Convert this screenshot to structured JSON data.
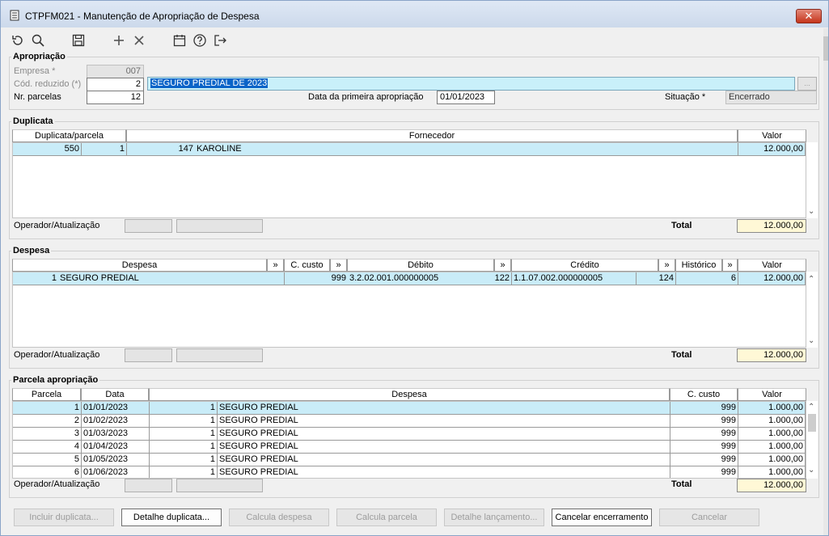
{
  "window": {
    "title": "CTPFM021 - Manutenção de Apropriação de Despesa",
    "close": "✕"
  },
  "toolbar": {
    "icons": [
      "refresh-icon",
      "search-icon",
      "save-icon",
      "add-icon",
      "delete-icon",
      "calendar-icon",
      "help-icon",
      "exit-icon"
    ]
  },
  "apropriacao": {
    "legend": "Apropriação",
    "empresa_label": "Empresa *",
    "empresa_value": "007",
    "cod_label": "Cód. reduzido (*)",
    "cod_value": "2",
    "cod_desc": "SEGURO PREDIAL DE 2023",
    "lookup_btn": "...",
    "nr_parcelas_label": "Nr. parcelas",
    "nr_parcelas_value": "12",
    "data_label": "Data da primeira apropriação",
    "data_value": "01/01/2023",
    "situacao_label": "Situação *",
    "situacao_value": "Encerrado"
  },
  "duplicata": {
    "legend": "Duplicata",
    "headers": [
      "Duplicata/parcela",
      "Fornecedor",
      "Valor"
    ],
    "rows": [
      {
        "duplicata": "550",
        "parcela": "1",
        "fornecedor_cod": "147",
        "fornecedor_nome": "KAROLINE",
        "valor": "12.000,00"
      }
    ],
    "operador_label": "Operador/Atualização",
    "total_label": "Total",
    "total_value": "12.000,00"
  },
  "despesa": {
    "legend": "Despesa",
    "headers": [
      "Despesa",
      "»",
      "C. custo",
      "»",
      "Débito",
      "»",
      "Crédito",
      "»",
      "Histórico",
      "»",
      "Valor"
    ],
    "rows": [
      {
        "cod": "1",
        "nome": "SEGURO PREDIAL",
        "ccusto": "999",
        "debito": "3.2.02.001.000000005",
        "debito_cod": "122",
        "credito": "1.1.07.002.000000005",
        "credito_cod": "124",
        "historico": "6",
        "valor": "12.000,00"
      }
    ],
    "operador_label": "Operador/Atualização",
    "total_label": "Total",
    "total_value": "12.000,00"
  },
  "parcela": {
    "legend": "Parcela apropriação",
    "headers": [
      "Parcela",
      "Data",
      "Despesa",
      "C. custo",
      "Valor"
    ],
    "rows": [
      {
        "parcela": "1",
        "data": "01/01/2023",
        "desp_cod": "1",
        "despesa": "SEGURO PREDIAL",
        "ccusto": "999",
        "valor": "1.000,00"
      },
      {
        "parcela": "2",
        "data": "01/02/2023",
        "desp_cod": "1",
        "despesa": "SEGURO PREDIAL",
        "ccusto": "999",
        "valor": "1.000,00"
      },
      {
        "parcela": "3",
        "data": "01/03/2023",
        "desp_cod": "1",
        "despesa": "SEGURO PREDIAL",
        "ccusto": "999",
        "valor": "1.000,00"
      },
      {
        "parcela": "4",
        "data": "01/04/2023",
        "desp_cod": "1",
        "despesa": "SEGURO PREDIAL",
        "ccusto": "999",
        "valor": "1.000,00"
      },
      {
        "parcela": "5",
        "data": "01/05/2023",
        "desp_cod": "1",
        "despesa": "SEGURO PREDIAL",
        "ccusto": "999",
        "valor": "1.000,00"
      },
      {
        "parcela": "6",
        "data": "01/06/2023",
        "desp_cod": "1",
        "despesa": "SEGURO PREDIAL",
        "ccusto": "999",
        "valor": "1.000,00"
      }
    ],
    "operador_label": "Operador/Atualização",
    "total_label": "Total",
    "total_value": "12.000,00"
  },
  "buttons": {
    "incluir_duplicata": "Incluir duplicata...",
    "detalhe_duplicata": "Detalhe duplicata...",
    "calcula_despesa": "Calcula despesa",
    "calcula_parcela": "Calcula parcela",
    "detalhe_lancamento": "Detalhe lançamento...",
    "cancelar_encerramento": "Cancelar encerramento",
    "cancelar": "Cancelar"
  }
}
